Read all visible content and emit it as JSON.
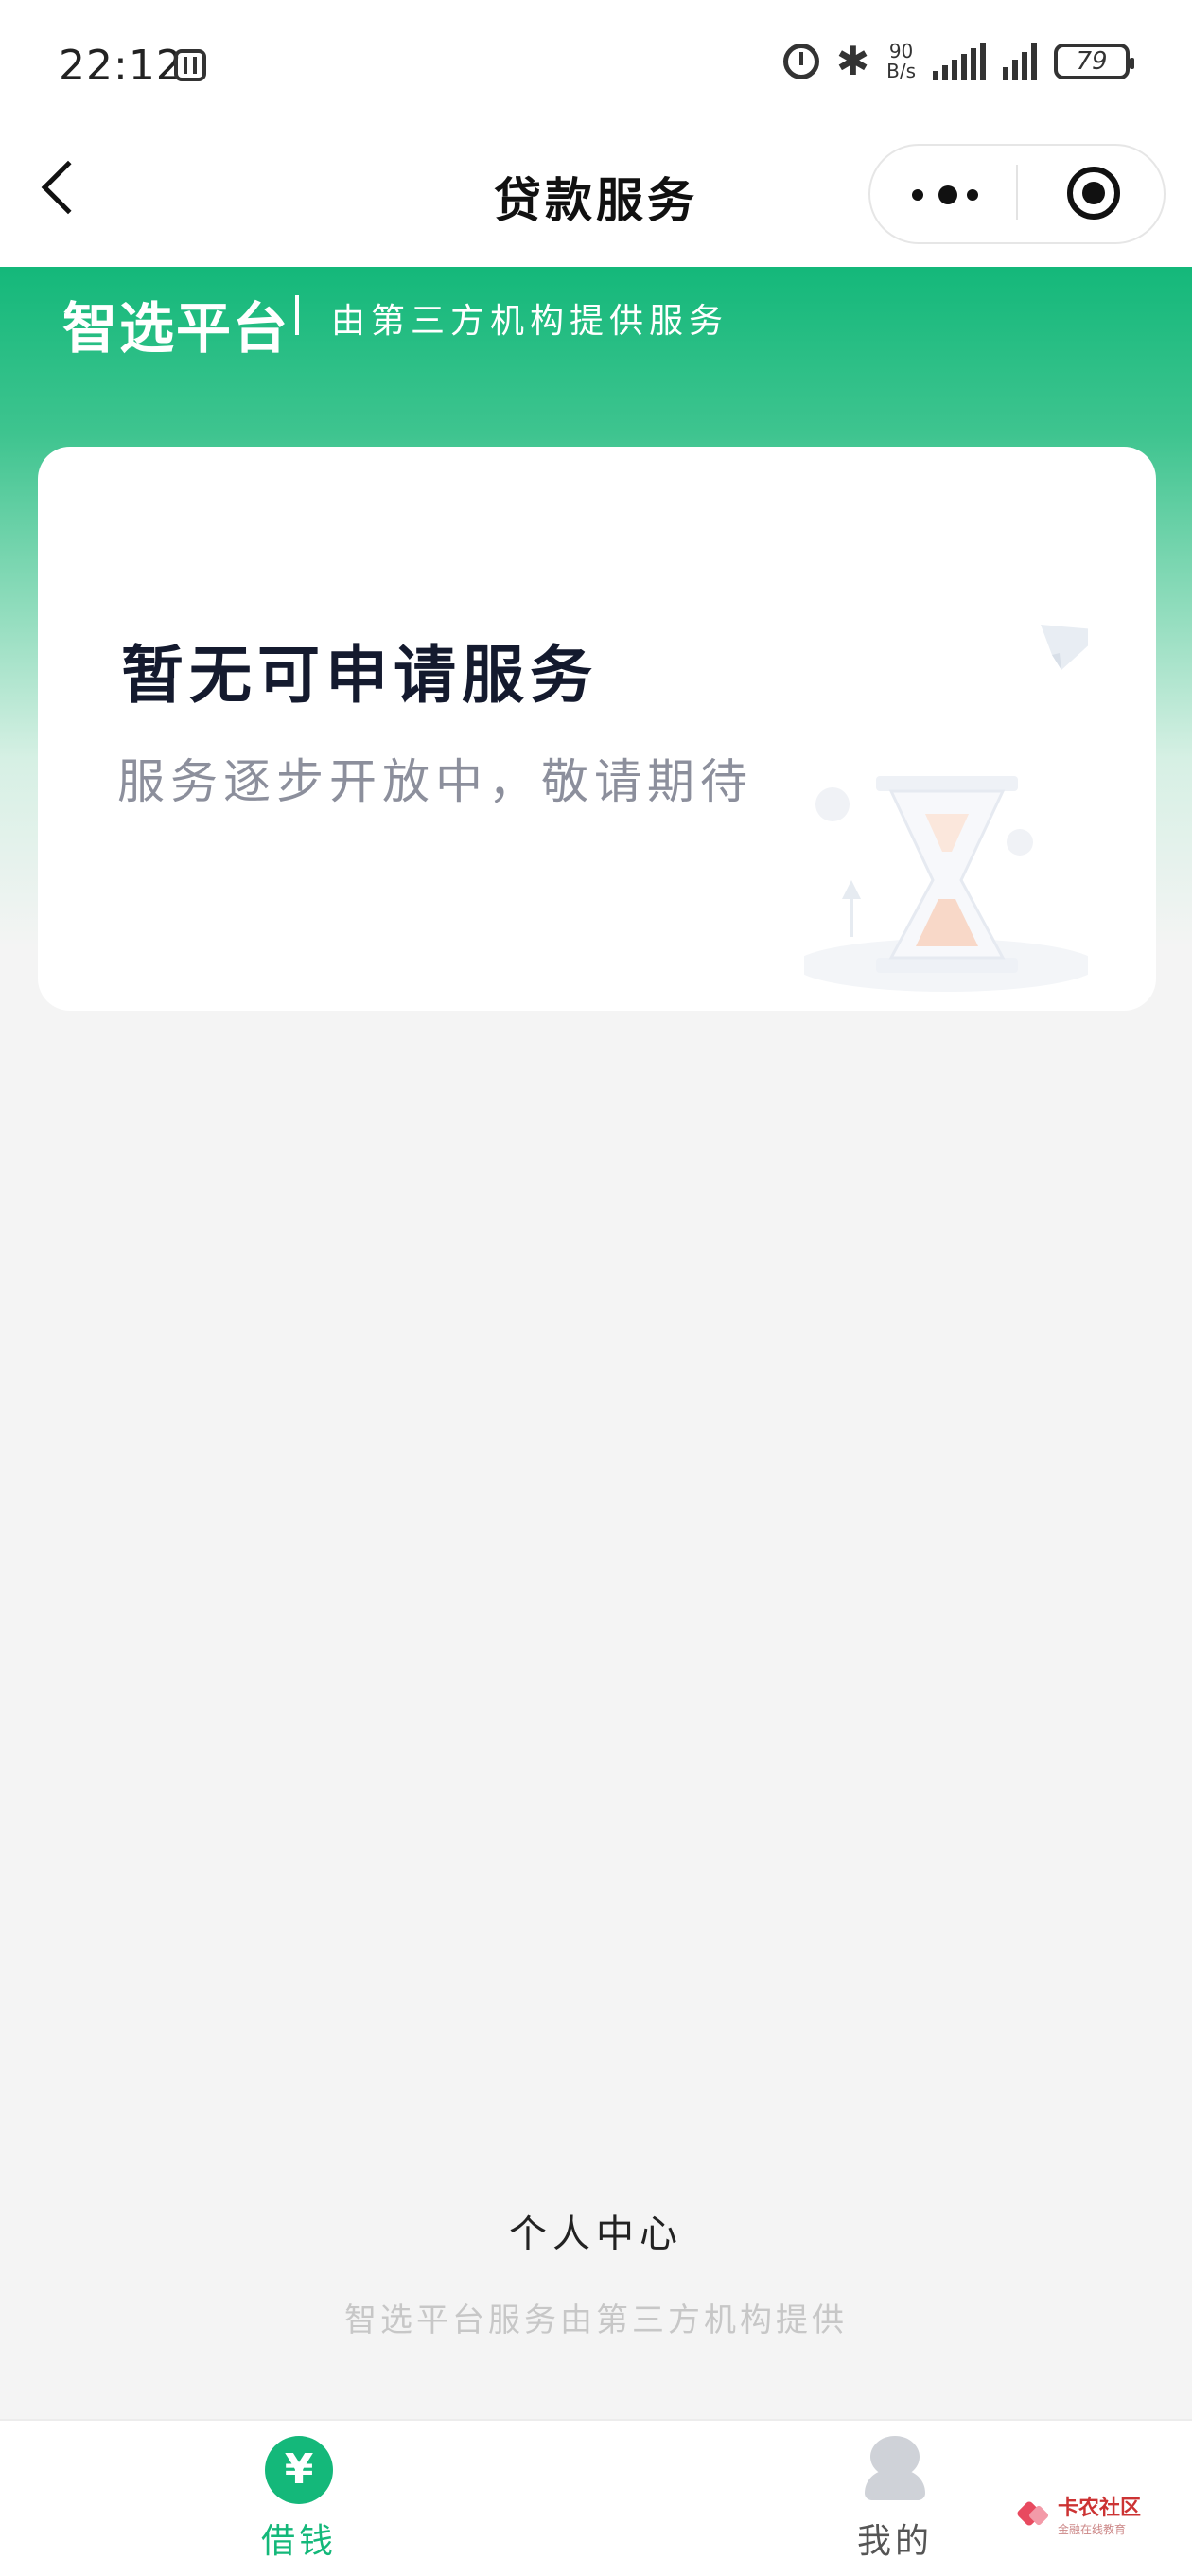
{
  "status_bar": {
    "time": "22:12",
    "net_speed_value": "90",
    "net_speed_unit": "B/s",
    "battery": "79",
    "icons": [
      "nfc-icon",
      "alarm-icon",
      "bluetooth-icon",
      "signal-icon",
      "signal-icon",
      "battery-icon"
    ]
  },
  "nav": {
    "title": "贷款服务",
    "icons": [
      "back-icon",
      "more-icon",
      "target-icon"
    ]
  },
  "hero": {
    "brand": "智选平台",
    "subtitle": "由第三方机构提供服务"
  },
  "card": {
    "title": "暂无可申请服务",
    "subtitle": "服务逐步开放中，敬请期待",
    "illustration": "hourglass-icon"
  },
  "footer": {
    "personal_center": "个人中心",
    "note": "智选平台服务由第三方机构提供"
  },
  "tabbar": {
    "tabs": [
      {
        "label": "借钱",
        "icon": "yuan-icon",
        "glyph": "¥",
        "active": true
      },
      {
        "label": "我的",
        "icon": "user-icon",
        "active": false
      }
    ]
  },
  "watermark": {
    "name": "卡农社区",
    "tagline": "金融在线教育"
  },
  "colors": {
    "accent": "#14b87a",
    "background": "#f4f4f4",
    "card_title": "#141a2e",
    "card_subtitle": "#8c8f9c"
  }
}
